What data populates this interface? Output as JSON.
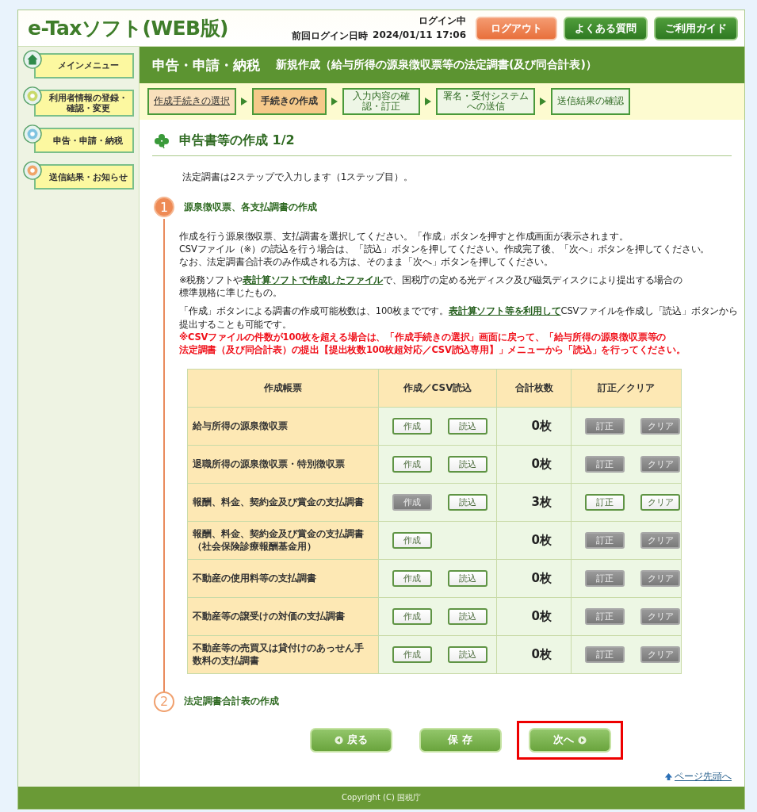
{
  "header": {
    "logo": "e-Taxソフト(WEB版)",
    "login_status": "ログイン中",
    "last_login_label": "前回ログイン日時",
    "last_login": "2024/01/11 17:06",
    "buttons": [
      {
        "label": "ログアウト",
        "kind": "logout"
      },
      {
        "label": "よくある質問",
        "kind": "help"
      },
      {
        "label": "ご利用ガイド",
        "kind": "help"
      }
    ]
  },
  "sidebar": {
    "items": [
      {
        "label": "メインメニュー"
      },
      {
        "label": "利用者情報の登録・確認・変更"
      },
      {
        "label": "申告・申請・納税"
      },
      {
        "label": "送信結果・お知らせ"
      }
    ]
  },
  "title_bar": {
    "title": "申告・申請・納税",
    "subtitle": "新規作成（給与所得の源泉徴収票等の法定調書(及び同合計表)）"
  },
  "progress_steps": [
    {
      "label": "作成手続きの選択",
      "kind": "link"
    },
    {
      "label": "手続きの作成",
      "kind": "current"
    },
    {
      "label": "入力内容の確認・訂正",
      "kind": "pending"
    },
    {
      "label": "署名・受付システムへの送信",
      "kind": "pending"
    },
    {
      "label": "送信結果の確認",
      "kind": "pending"
    }
  ],
  "heading": "申告書等の作成 1/2",
  "intro": "法定調書は2ステップで入力します（1ステップ目）。",
  "sections": [
    {
      "number": "1",
      "title": "源泉徴収票、各支払調書の作成",
      "selected": true,
      "paragraphs": [
        {
          "kind": "plain",
          "lines": [
            [
              {
                "text": "作成を行う源泉徴収票、支払調書を選択してください。「作成」ボタンを押すと作成画面が表示されます。",
                "link": false
              }
            ],
            [
              {
                "text": "CSVファイル（※）の読込を行う場合は、「読込」ボタンを押してください。作成完了後、「次へ」ボタンを押してください。",
                "link": false
              }
            ],
            [
              {
                "text": "なお、法定調書合計表のみ作成される方は、そのまま「次へ」ボタンを押してください。",
                "link": false
              }
            ]
          ]
        },
        {
          "kind": "plain",
          "lines": [
            [
              {
                "text": "※税務ソフトや",
                "link": false
              },
              {
                "text": "表計算ソフトで作成したファイル",
                "link": true
              },
              {
                "text": "で、国税庁の定める光ディスク及び磁気ディスクにより提出する場合の",
                "link": false
              }
            ],
            [
              {
                "text": "標準規格に準じたもの。",
                "link": false
              }
            ]
          ]
        },
        {
          "kind": "plain",
          "lines": [
            [
              {
                "text": "「作成」ボタンによる調書の作成可能枚数は、100枚までです。",
                "link": false
              },
              {
                "text": "表計算ソフト等を利用して",
                "link": true
              },
              {
                "text": "CSVファイルを作成し「読込」ボタンから",
                "link": false
              }
            ],
            [
              {
                "text": "提出することも可能です。",
                "link": false
              }
            ]
          ]
        },
        {
          "kind": "warning",
          "lines": [
            [
              {
                "text": "※CSVファイルの件数が100枚を超える場合は、「作成手続きの選択」画面に戻って、「給与所得の源泉徴収票等の",
                "link": false
              }
            ],
            [
              {
                "text": "法定調書（及び同合計表）の提出【提出枚数100枚超対応／CSV読込専用】」メニューから「読込」を行ってください。",
                "link": false
              }
            ]
          ]
        }
      ],
      "table": {
        "columns": [
          "作成帳票",
          "作成／CSV読込",
          "合計枚数",
          "訂正／クリア"
        ],
        "rows": [
          {
            "form": "給与所得の源泉徴収票",
            "actions": [
              {
                "label": "作成",
                "disabled": false
              },
              {
                "label": "読込",
                "disabled": false
              }
            ],
            "count": "0枚",
            "edits": [
              {
                "label": "訂正",
                "disabled": true
              },
              {
                "label": "クリア",
                "disabled": true
              }
            ]
          },
          {
            "form": "退職所得の源泉徴収票・特別徴収票",
            "actions": [
              {
                "label": "作成",
                "disabled": false
              },
              {
                "label": "読込",
                "disabled": false
              }
            ],
            "count": "0枚",
            "edits": [
              {
                "label": "訂正",
                "disabled": true
              },
              {
                "label": "クリア",
                "disabled": true
              }
            ]
          },
          {
            "form": "報酬、料金、契約金及び賞金の支払調書",
            "actions": [
              {
                "label": "作成",
                "disabled": true
              },
              {
                "label": "読込",
                "disabled": false
              }
            ],
            "count": "3枚",
            "edits": [
              {
                "label": "訂正",
                "disabled": false
              },
              {
                "label": "クリア",
                "disabled": false
              }
            ]
          },
          {
            "form": "報酬、料金、契約金及び賞金の支払調書（社会保険診療報酬基金用）",
            "actions": [
              {
                "label": "作成",
                "disabled": false
              }
            ],
            "count": "0枚",
            "edits": [
              {
                "label": "訂正",
                "disabled": true
              },
              {
                "label": "クリア",
                "disabled": true
              }
            ]
          },
          {
            "form": "不動産の使用料等の支払調書",
            "actions": [
              {
                "label": "作成",
                "disabled": false
              },
              {
                "label": "読込",
                "disabled": false
              }
            ],
            "count": "0枚",
            "edits": [
              {
                "label": "訂正",
                "disabled": true
              },
              {
                "label": "クリア",
                "disabled": true
              }
            ]
          },
          {
            "form": "不動産等の譲受けの対価の支払調書",
            "actions": [
              {
                "label": "作成",
                "disabled": false
              },
              {
                "label": "読込",
                "disabled": false
              }
            ],
            "count": "0枚",
            "edits": [
              {
                "label": "訂正",
                "disabled": true
              },
              {
                "label": "クリア",
                "disabled": true
              }
            ]
          },
          {
            "form": "不動産等の売買又は貸付けのあっせん手数料の支払調書",
            "actions": [
              {
                "label": "作成",
                "disabled": false
              },
              {
                "label": "読込",
                "disabled": false
              }
            ],
            "count": "0枚",
            "edits": [
              {
                "label": "訂正",
                "disabled": true
              },
              {
                "label": "クリア",
                "disabled": true
              }
            ]
          }
        ]
      }
    },
    {
      "number": "2",
      "title": "法定調書合計表の作成",
      "selected": false
    }
  ],
  "nav_buttons": [
    {
      "label": "戻る",
      "kind": "back",
      "highlighted": false
    },
    {
      "label": "保 存",
      "kind": "save",
      "highlighted": false
    },
    {
      "label": "次へ",
      "kind": "next",
      "highlighted": true
    }
  ],
  "page_top_link": "ページ先頭へ",
  "footer": "Copyright (C) 国税庁"
}
